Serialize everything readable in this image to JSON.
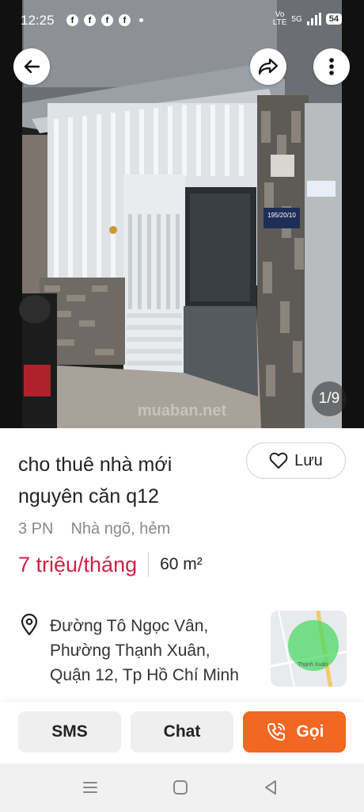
{
  "status_bar": {
    "time": "12:25",
    "app_icons": [
      "facebook-icon",
      "facebook-icon",
      "facebook-icon",
      "facebook-icon"
    ],
    "network_volte_top": "Vo",
    "network_volte_bottom": "LTE",
    "network_type": "5G",
    "battery_level": "54"
  },
  "photo": {
    "counter": "1/9",
    "house_number": "195/20/10",
    "watermark": "muaban.net"
  },
  "listing": {
    "title_line1": "cho thuê nhà mới",
    "title_line2": "nguyên căn q12",
    "save_label": "Lưu",
    "bedrooms": "3 PN",
    "property_type": "Nhà ngõ, hẻm",
    "price": "7 triệu/tháng",
    "area": "60 m²",
    "address_line1": "Đường Tô Ngọc Vân,",
    "address_line2": "Phường Thạnh Xuân,",
    "address_line3": "Quận 12, Tp Hồ Chí Minh",
    "map_label": "Thạnh Xuân"
  },
  "actions": {
    "sms_label": "SMS",
    "chat_label": "Chat",
    "call_label": "Gọi"
  },
  "colors": {
    "price": "#d21f47",
    "call_button": "#f26722",
    "secondary_button": "#efefef"
  }
}
